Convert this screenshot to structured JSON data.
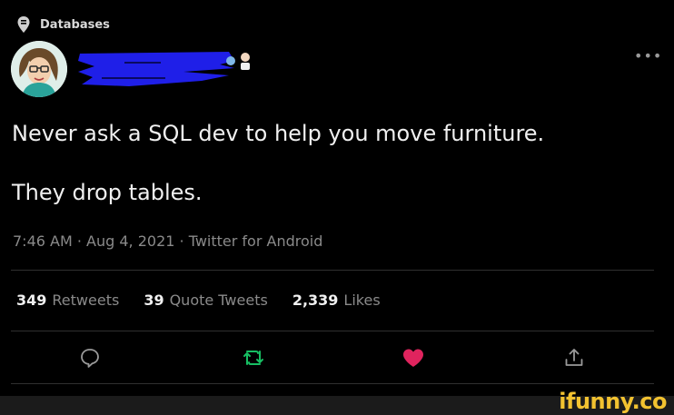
{
  "topic": {
    "icon": "location-pin-icon",
    "label": "Databases"
  },
  "author": {
    "avatar_icon": "avatar-icon",
    "name_redacted": true
  },
  "tweet": {
    "line1": "Never ask a SQL dev to help you move furniture.",
    "line2": "They drop tables."
  },
  "meta": {
    "time": "7:46 AM",
    "date": "Aug 4, 2021",
    "source": "Twitter for Android",
    "separator": " · "
  },
  "stats": [
    {
      "count": "349",
      "label": "Retweets"
    },
    {
      "count": "39",
      "label": "Quote Tweets"
    },
    {
      "count": "2,339",
      "label": "Likes"
    }
  ],
  "actions": [
    {
      "icon": "reply-icon"
    },
    {
      "icon": "retweet-icon"
    },
    {
      "icon": "like-icon"
    },
    {
      "icon": "share-icon"
    }
  ],
  "more_icon": "more-options-icon",
  "watermark": "ifunny.co",
  "colors": {
    "background": "#000000",
    "retweet": "#17bf63",
    "like": "#e0245e",
    "redaction": "#1f1fe8",
    "watermark": "#f2c230"
  }
}
